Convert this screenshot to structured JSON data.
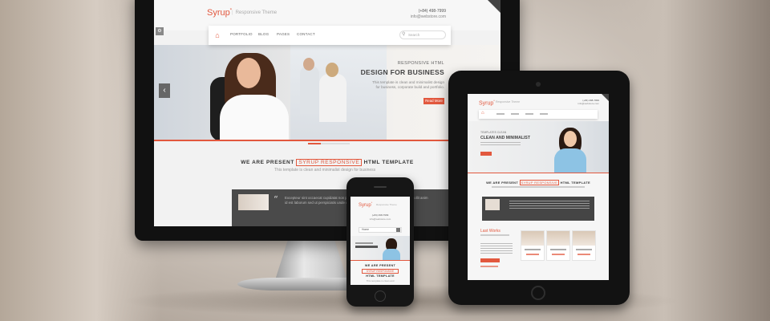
{
  "monitor": {
    "header": {
      "logo": "Syrup",
      "logo_mark": "*",
      "tagline": "Responsive Theme",
      "phone": "(+84) 498-7999",
      "email": "info@webstore.com"
    },
    "nav": {
      "items": [
        "PORTFOLIO",
        "BLOG",
        "PAGES",
        "CONTACT"
      ],
      "search_placeholder": "Search"
    },
    "hero": {
      "kicker": "RESPONSIVE HTML",
      "title": "DESIGN FOR BUSINESS",
      "text": "This template is clean and minimalist design for business, corporate build and portfolio.",
      "button": "Read More"
    },
    "present": {
      "prefix": "WE ARE PRESENT",
      "highlight": "SYRUP RESPONSIVE",
      "suffix": "HTML TEMPLATE",
      "sub": "This template is clean and minimalist design for business"
    },
    "testimonial": {
      "text": "Excepteur sint occaecat cupidatat non proident, sunt in culpa qui officia deserunt mollit anim id est laborum sed ut perspiciatis unde omnis iste natus"
    }
  },
  "tablet": {
    "header": {
      "logo": "Syrup",
      "logo_mark": "*",
      "tagline": "Responsive Theme",
      "phone": "(+84) 498-7999",
      "email": "info@webstore.com"
    },
    "hero": {
      "kicker": "TEMPLATES CLEAN",
      "title": "CLEAN AND MINIMALIST"
    },
    "present": {
      "prefix": "WE ARE PRESENT",
      "highlight": "SYRUP RESPONSIVE",
      "suffix": "HTML TEMPLATE"
    },
    "latest_works": "Last Works"
  },
  "phone_device": {
    "header": {
      "logo": "Syrup",
      "logo_mark": "*",
      "tagline": "Responsive Theme",
      "phone": "(+84) 498-7999",
      "email": "info@webstore.com"
    },
    "select_label": "Home",
    "present": {
      "line1": "WE ARE PRESENT",
      "line2": "SYRUP RESPONSIVE",
      "line3": "HTML TEMPLATE",
      "line4": "This template is clean and"
    }
  },
  "icons": {
    "home": "home-icon",
    "search": "search-icon",
    "arrow_left": "chevron-left-icon",
    "quote": "quote-icon"
  },
  "colors": {
    "accent": "#e2583e",
    "dark_panel": "#4a4a4a",
    "device_bezel": "#111111"
  }
}
